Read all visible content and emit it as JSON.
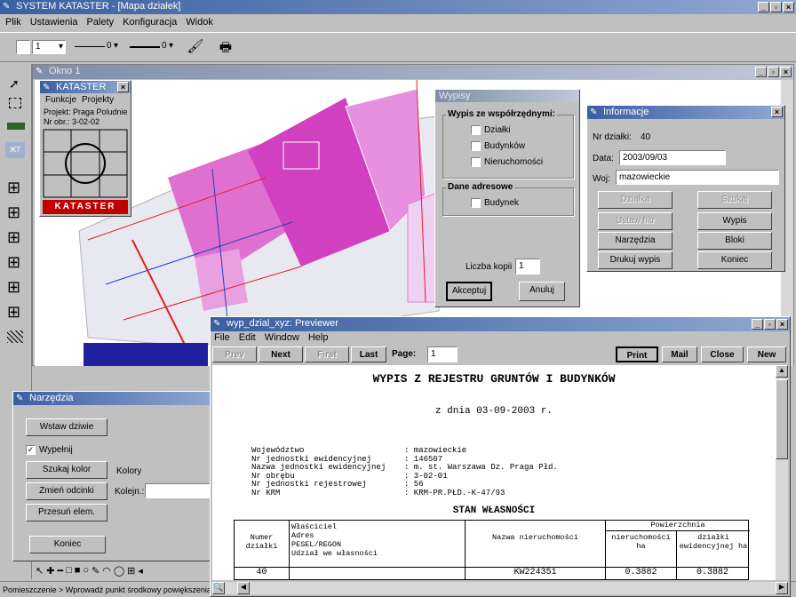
{
  "main": {
    "title": "SYSTEM KATASTER - [Mapa działek]",
    "menu": [
      "Plik",
      "Ustawienia",
      "Palety",
      "Konfiguracja",
      "Widok"
    ],
    "toolbar": {
      "layer_value": "1",
      "line1_value": "0",
      "line2_value": "0"
    }
  },
  "map_window": {
    "title": "Okno 1"
  },
  "kataster_palette": {
    "title": "KATASTER",
    "menu": [
      "Funkcje",
      "Projekty"
    ],
    "project_line": "Projekt: Praga Poludnie",
    "obreb_line": "Nr obr.: 3-02-02",
    "logo_text": "KATASTER"
  },
  "wypisy_dialog": {
    "title": "Wypisy",
    "group1_title": "Wypis ze współrzędnymi:",
    "checkboxes1": [
      "Działki",
      "Budynków",
      "Nieruchomości"
    ],
    "group2_title": "Dane adresowe",
    "checkboxes2": [
      "Budynek"
    ],
    "copies_label": "Liczba kopii",
    "copies_value": "1",
    "ok_label": "Akceptuj",
    "cancel_label": "Anuluj"
  },
  "info_dialog": {
    "title": "Informacje",
    "parcel_label": "Nr działki:",
    "parcel_value": "40",
    "date_label": "Data:",
    "date_value": "2003/09/03",
    "voivodeship_label": "Woj:",
    "voivodeship_value": "mazowieckie",
    "btn_row1": [
      "Działka",
      "Szukaj"
    ],
    "btn_row2": [
      "Ustaw filtr",
      "Wypis"
    ],
    "btn_row3": [
      "Narzędzia",
      "Bloki"
    ],
    "btn_row4": [
      "Drukuj wypis",
      "Koniec"
    ]
  },
  "tools_dialog": {
    "title": "Narzędzia",
    "btn_insert": "Wstaw dziwie",
    "fill_label": "Wypełnij",
    "btn_search_color": "Szukaj kolor",
    "colors_label": "Kolory",
    "btn_change_segment": "Zmień odcinki",
    "order_label": "Kolejn.:",
    "btn_move": "Przesuń elem.",
    "btn_end": "Koniec"
  },
  "status_bar": "Pomieszczenie > Wprowadź punkt środkowy powiększenia",
  "previewer": {
    "title": "wyp_dzial_xyz: Previewer",
    "menu": [
      "File",
      "Edit",
      "Window",
      "Help"
    ],
    "nav": {
      "prev": "Prev",
      "next": "Next",
      "first": "First",
      "last": "Last",
      "page_label": "Page:",
      "page_value": "1"
    },
    "actions": {
      "print": "Print",
      "mail": "Mail",
      "close": "Close",
      "new": "New"
    },
    "doc": {
      "heading": "WYPIS Z REJESTRU GRUNTÓW I BUDYNKÓW",
      "date_line": "z dnia 03-09-2003 r.",
      "fields": [
        {
          "label": "Województwo",
          "value": ": mazowieckie"
        },
        {
          "label": "Nr jednostki ewidencyjnej",
          "value": ": 146507"
        },
        {
          "label": "Nazwa jednostki ewidencyjnej",
          "value": ": m. st. Warszawa Dz. Praga Płd."
        },
        {
          "label": "Nr obrębu",
          "value": ": 3-02-01"
        },
        {
          "label": "Nr jednostki rejestrowej",
          "value": ": 56"
        },
        {
          "label": "Nr KRM",
          "value": ": KRM-PR.PŁD.-K-47/93"
        }
      ],
      "section_title": "STAN WŁASNOŚCI",
      "table_header": {
        "col1": "Numer działki",
        "col2_lines": [
          "Właściciel",
          "Adres",
          "PESEL/REGON",
          "Udział we własności"
        ],
        "col3": "Nazwa nieruchomości",
        "area_group": "Powierzchnia",
        "col4": "nieruchomości ha",
        "col5": "działki ewidencyjnej ha"
      },
      "row": {
        "parcel": "40",
        "owner": "",
        "name": "KW224351",
        "area1": "0.3882",
        "area2": "0.3882"
      }
    }
  },
  "colors": {
    "title_active": "#3a5fa0",
    "parcel_magenta": "#d040c0",
    "map_bg": "#ffffff",
    "desktop": "#6a9fc4"
  }
}
